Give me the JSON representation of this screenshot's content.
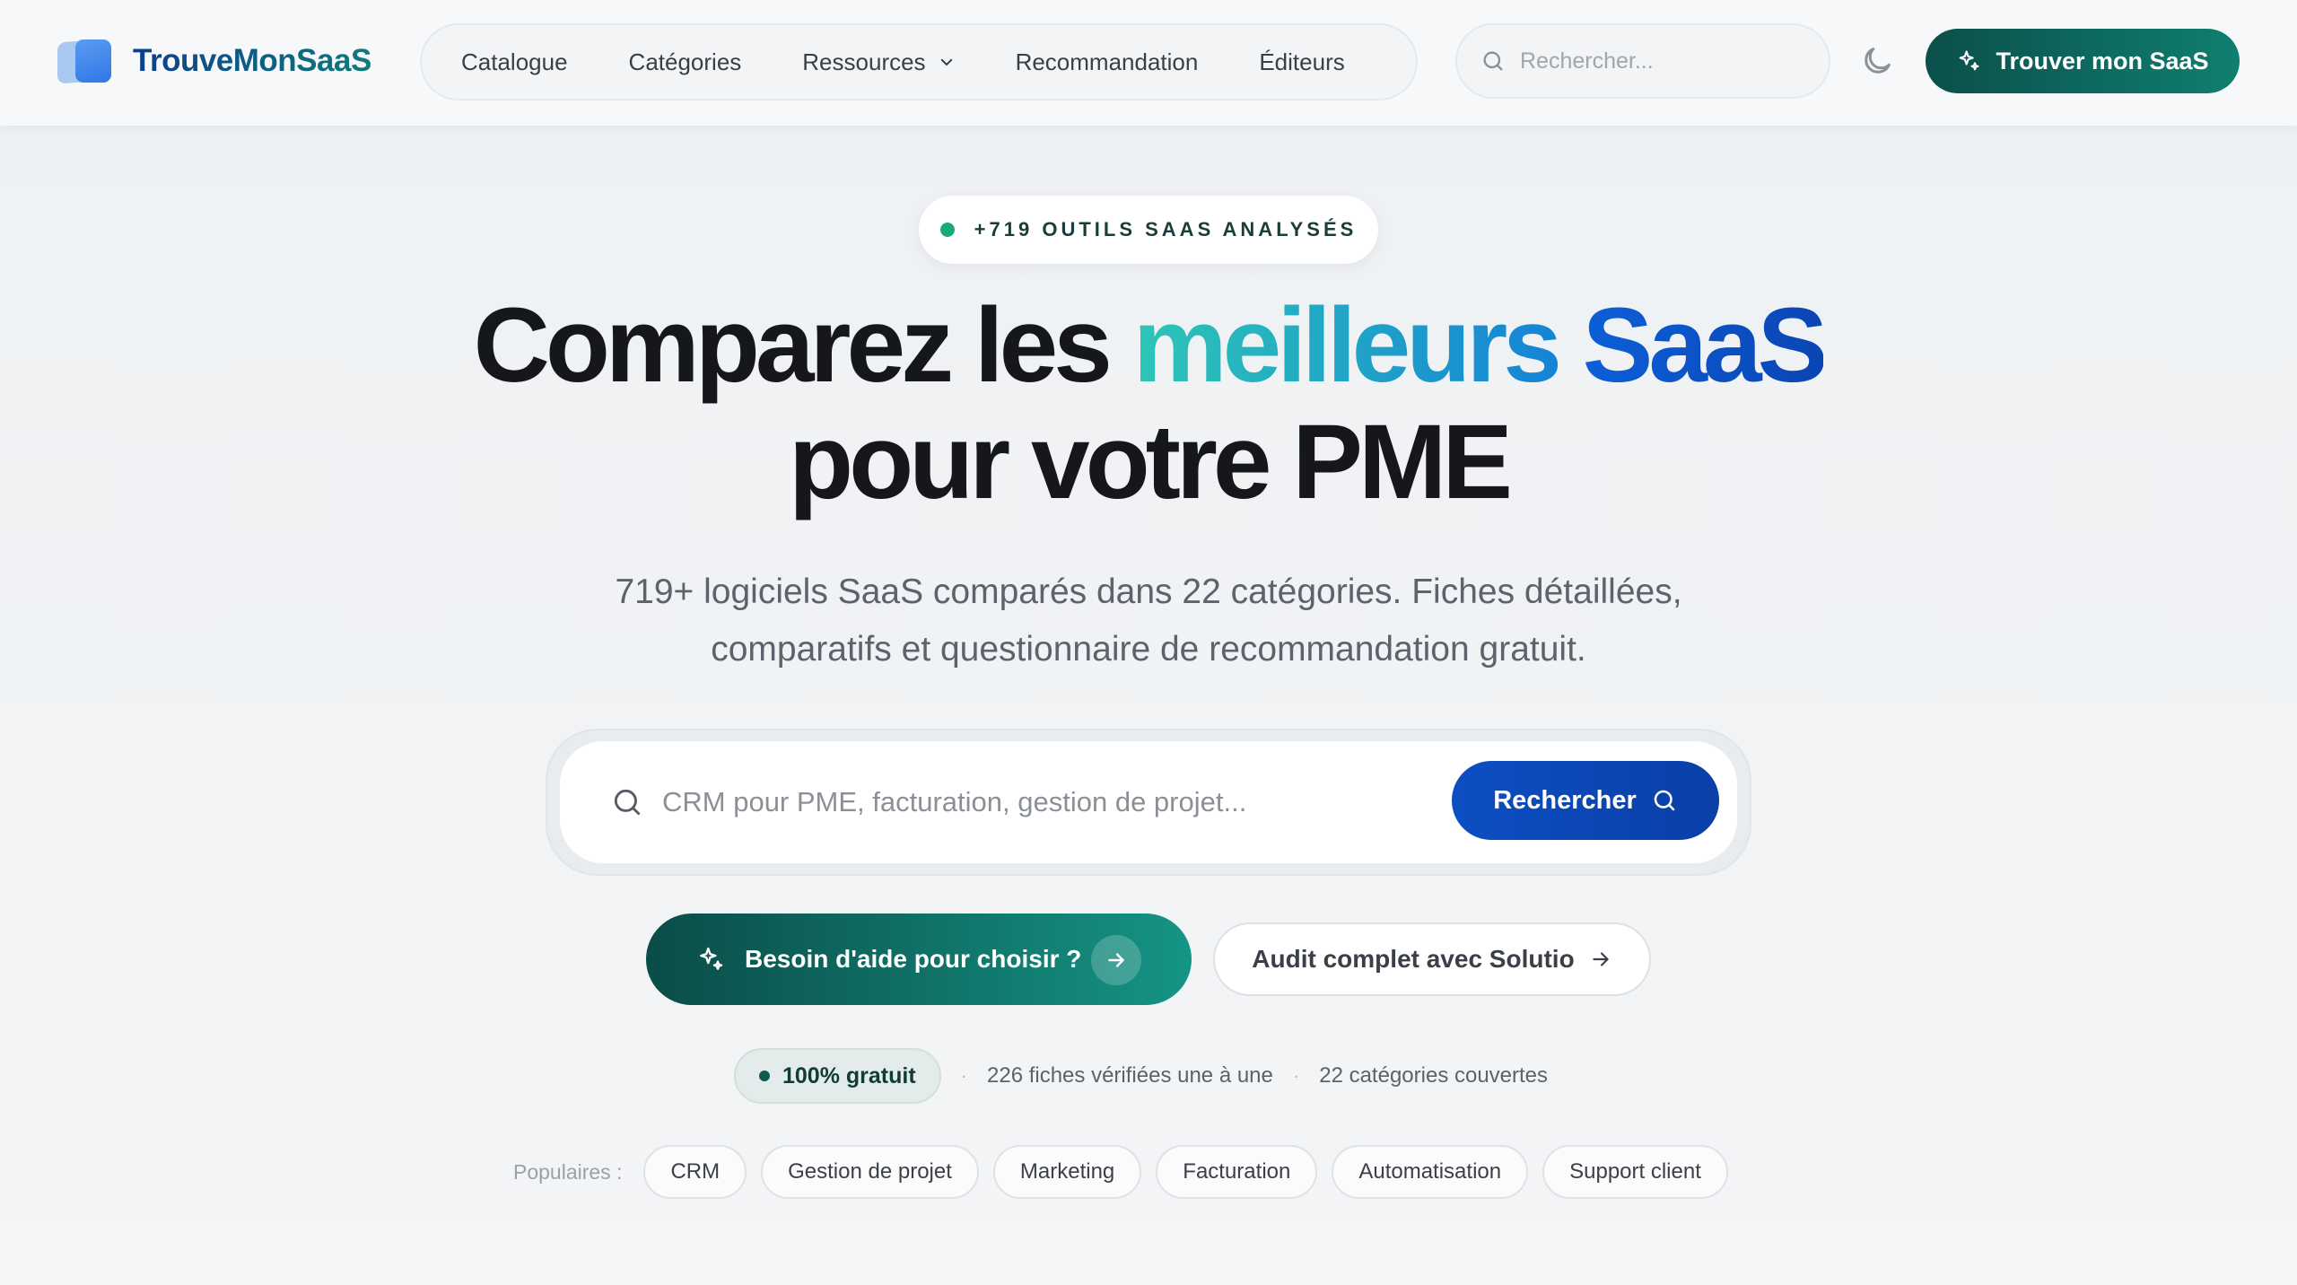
{
  "header": {
    "logo_text": "TrouveMonSaaS",
    "nav": [
      {
        "label": "Catalogue"
      },
      {
        "label": "Catégories"
      },
      {
        "label": "Ressources"
      },
      {
        "label": "Recommandation"
      },
      {
        "label": "Éditeurs"
      }
    ],
    "search_placeholder": "Rechercher...",
    "cta_label": "Trouver mon SaaS"
  },
  "hero": {
    "badge": "+719 OUTILS SAAS ANALYSÉS",
    "title_part1": "Comparez les ",
    "title_highlight1": "meilleurs",
    "title_highlight2": "SaaS",
    "title_line2": "pour votre PME",
    "subtitle_line1": "719+ logiciels SaaS comparés dans 22 catégories. Fiches détaillées,",
    "subtitle_line2": "comparatifs et questionnaire de recommandation gratuit.",
    "search_placeholder": "CRM pour PME, facturation, gestion de projet...",
    "search_button": "Rechercher",
    "help_button": "Besoin d'aide pour choisir ?",
    "audit_button": "Audit complet avec Solutio",
    "stats": {
      "free": "100% gratuit",
      "verified": "226 fiches vérifiées une à une",
      "categories": "22 catégories couvertes",
      "separator": "·"
    },
    "popular_label": "Populaires :",
    "popular_chips": [
      "CRM",
      "Gestion de projet",
      "Marketing",
      "Facturation",
      "Automatisation",
      "Support client"
    ]
  },
  "colors": {
    "brand_teal": "#0f7f6f",
    "brand_blue": "#0c4fc2",
    "accent_green": "#16a97e"
  }
}
